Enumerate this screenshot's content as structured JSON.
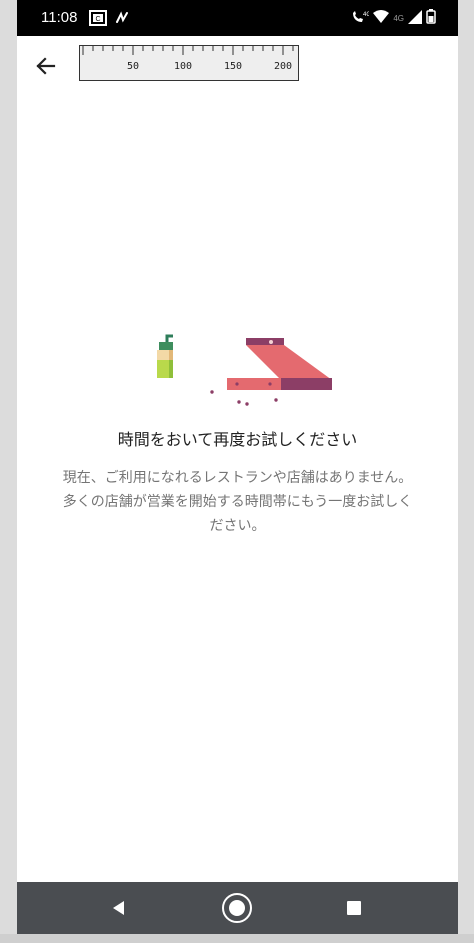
{
  "status_bar": {
    "time": "11:08",
    "network_label": "4G",
    "icons": [
      "notification-app-icon",
      "squiggle-icon",
      "volte-icon",
      "wifi-icon",
      "signal-icon",
      "battery-icon"
    ]
  },
  "app_bar": {
    "back_icon": "arrow-left-icon",
    "ruler_labels": [
      "50",
      "100",
      "150",
      "200"
    ]
  },
  "empty_state": {
    "title": "時間をおいて再度お試しください",
    "description_line1": "現在、ご利用になれるレストランや店舗はありません。",
    "description_line2": "多くの店舗が営業を開始する時間帯にもう一度お試しく",
    "description_line3": "ださい。"
  },
  "nav_bar": {
    "back_icon": "triangle-back-icon",
    "home_icon": "circle-home-icon",
    "recents_icon": "square-recents-icon"
  },
  "colors": {
    "status_bar_bg": "#000000",
    "nav_bar_bg": "#4a4d51",
    "pizza_box_red": "#e46a6f",
    "pizza_box_dark": "#8c3e66",
    "drink_green": "#b9d94b",
    "text_primary": "#222222",
    "text_secondary": "#757575"
  }
}
